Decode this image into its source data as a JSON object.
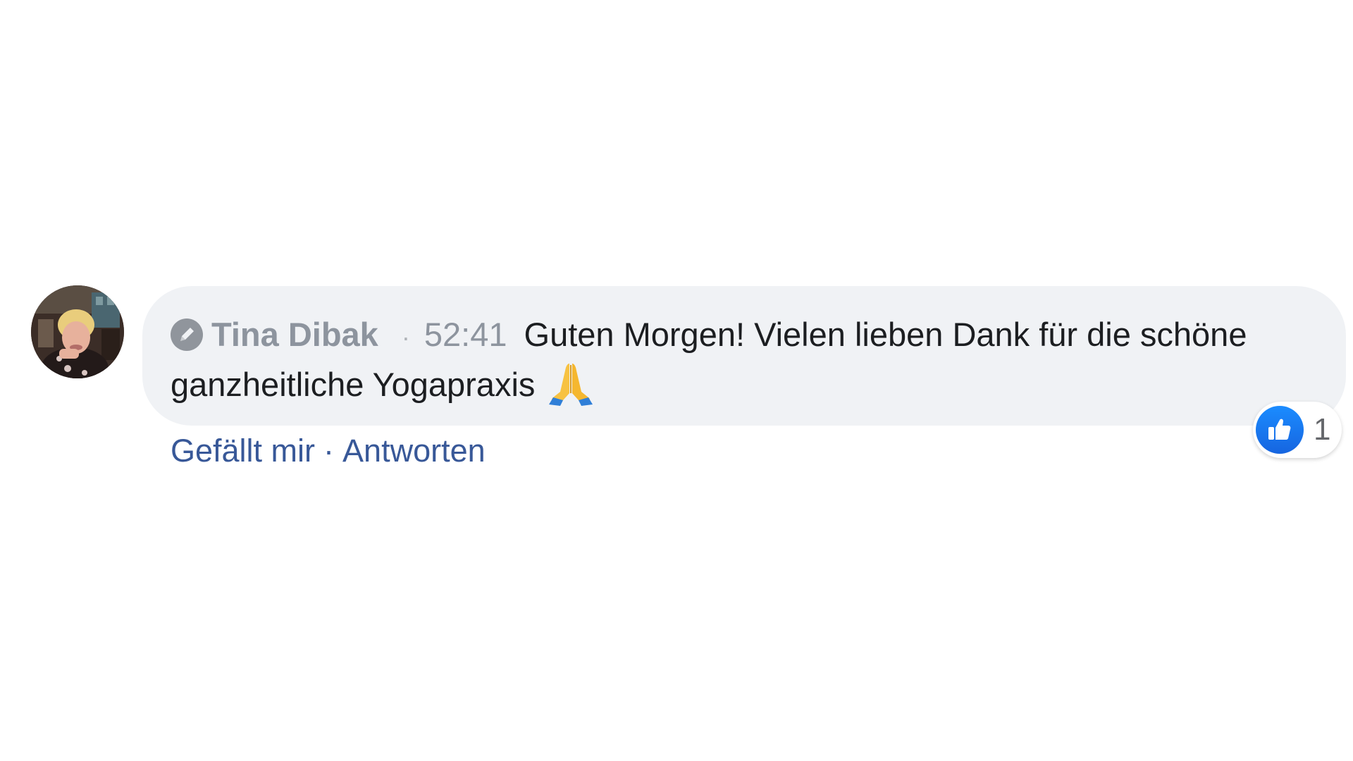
{
  "comment": {
    "author": "Tina Dibak",
    "separator": "·",
    "timestamp": "52:41",
    "text": "Guten Morgen! Vielen lieben Dank für die schöne ganzheitliche Yogapraxis",
    "emoji": "folded-hands-emoji",
    "edit_icon": "pencil-icon"
  },
  "actions": {
    "like_label": "Gefällt mir",
    "separator": "·",
    "reply_label": "Antworten"
  },
  "reactions": {
    "icon": "thumbs-up-icon",
    "count": "1",
    "like_color": "#1877f2"
  },
  "colors": {
    "bubble_bg": "#f0f2f5",
    "link": "#385898",
    "meta": "#8d949e",
    "text": "#1c1e21"
  }
}
